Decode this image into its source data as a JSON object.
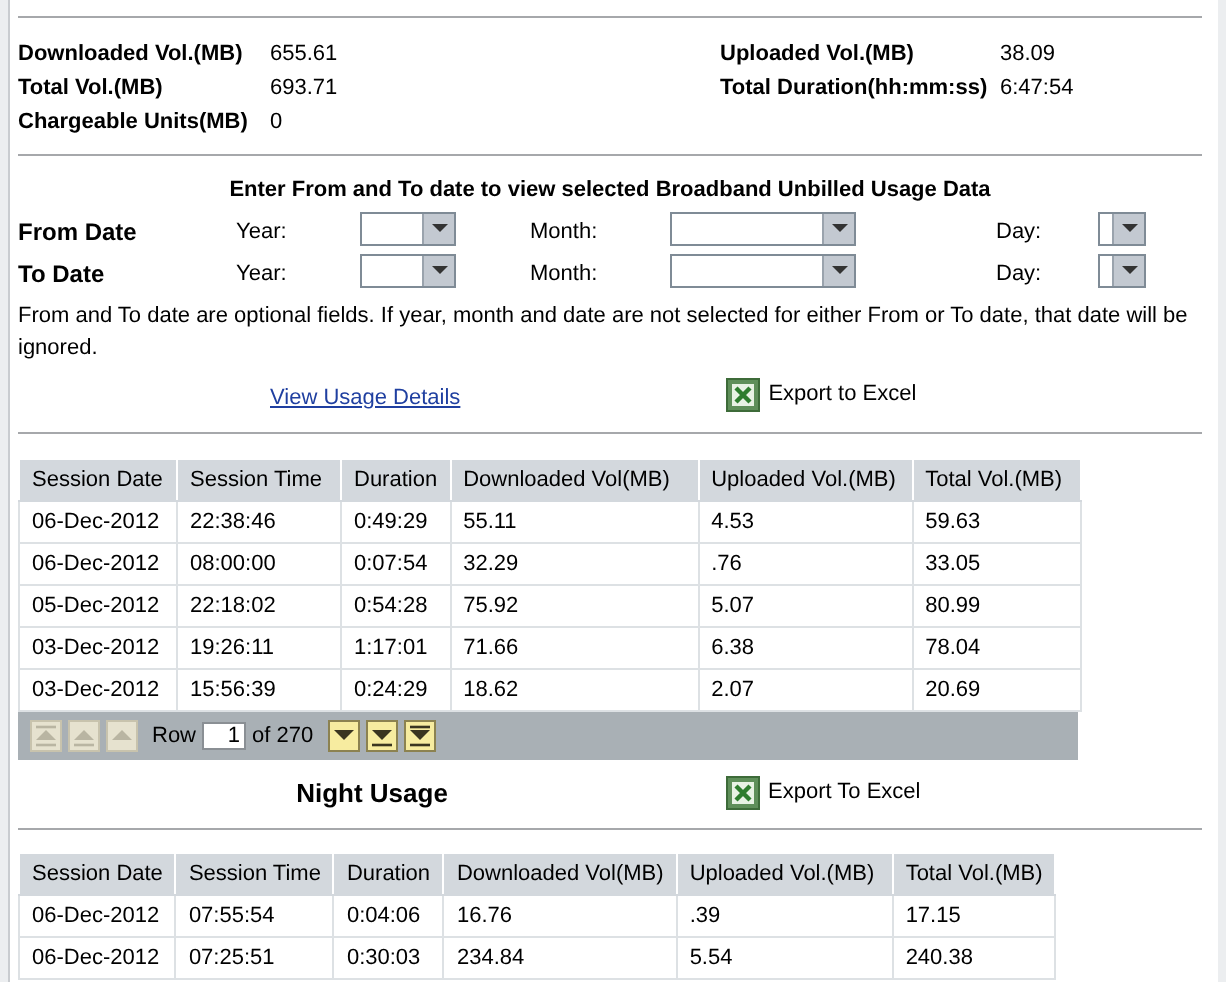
{
  "summary": {
    "left": [
      {
        "label": "Downloaded Vol.(MB)",
        "value": "655.61"
      },
      {
        "label": "Total Vol.(MB)",
        "value": "693.71"
      },
      {
        "label": "Chargeable Units(MB)",
        "value": "0"
      }
    ],
    "right": [
      {
        "label": "Uploaded Vol.(MB)",
        "value": "38.09"
      },
      {
        "label": "Total Duration(hh:mm:ss)",
        "value": "6:47:54"
      }
    ]
  },
  "filter": {
    "heading": "Enter From and To date to view selected Broadband Unbilled Usage Data",
    "rows": [
      {
        "label": "From Date",
        "fields": [
          {
            "kind": "year",
            "label": "Year:"
          },
          {
            "kind": "month",
            "label": "Month:"
          },
          {
            "kind": "day",
            "label": "Day:"
          }
        ]
      },
      {
        "label": "To Date",
        "fields": [
          {
            "kind": "year",
            "label": "Year:"
          },
          {
            "kind": "month",
            "label": "Month:"
          },
          {
            "kind": "day",
            "label": "Day:"
          }
        ]
      }
    ],
    "note": "From and To date are optional fields. If year, month and date are not selected for either From or To date, that date will be ignored.",
    "link": "View Usage Details",
    "export": "Export to Excel"
  },
  "sessions": {
    "columns": [
      "Session Date",
      "Session Time",
      "Duration",
      "Downloaded Vol(MB)",
      "Uploaded Vol.(MB)",
      "Total Vol.(MB)"
    ],
    "rows": [
      [
        "06-Dec-2012",
        "22:38:46",
        "0:49:29",
        "55.11",
        "4.53",
        "59.63"
      ],
      [
        "06-Dec-2012",
        "08:00:00",
        "0:07:54",
        "32.29",
        ".76",
        "33.05"
      ],
      [
        "05-Dec-2012",
        "22:18:02",
        "0:54:28",
        "75.92",
        "5.07",
        "80.99"
      ],
      [
        "03-Dec-2012",
        "19:26:11",
        "1:17:01",
        "71.66",
        "6.38",
        "78.04"
      ],
      [
        "03-Dec-2012",
        "15:56:39",
        "0:24:29",
        "18.62",
        "2.07",
        "20.69"
      ]
    ],
    "pager": {
      "buttons": [
        {
          "kind": "first",
          "disabled": true
        },
        {
          "kind": "previous",
          "disabled": true
        },
        {
          "kind": "up",
          "disabled": true
        },
        {
          "kind": "down",
          "disabled": false
        },
        {
          "kind": "next",
          "disabled": false
        },
        {
          "kind": "last",
          "disabled": false
        }
      ],
      "row_label": "Row",
      "row_value": "1",
      "of": "of 270"
    }
  },
  "night": {
    "title": "Night Usage",
    "export": "Export To Excel",
    "columns": [
      "Session Date",
      "Session Time",
      "Duration",
      "Downloaded Vol(MB)",
      "Uploaded Vol.(MB)",
      "Total Vol.(MB)"
    ],
    "rows": [
      [
        "06-Dec-2012",
        "07:55:54",
        "0:04:06",
        "16.76",
        ".39",
        "17.15"
      ],
      [
        "06-Dec-2012",
        "07:25:51",
        "0:30:03",
        "234.84",
        "5.54",
        "240.38"
      ]
    ]
  }
}
